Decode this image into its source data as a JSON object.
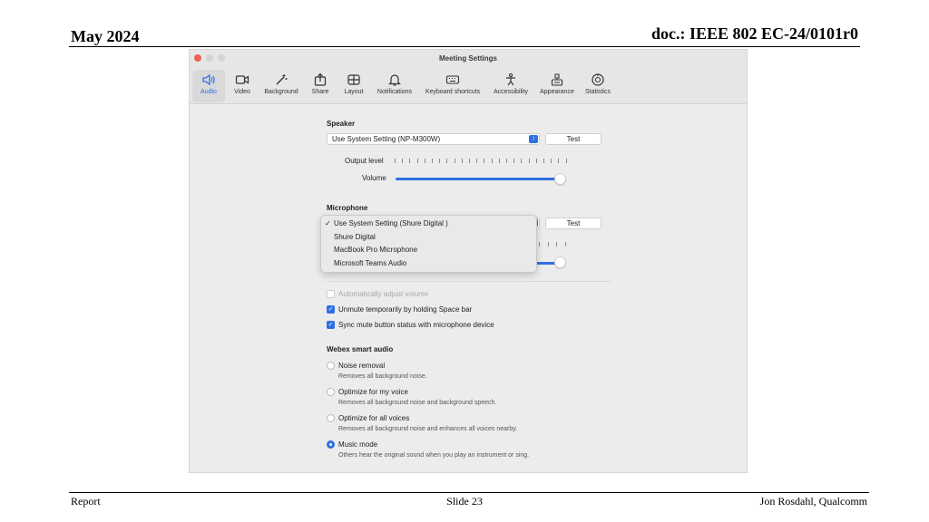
{
  "slide": {
    "date": "May 2024",
    "doc": "doc.: IEEE 802 EC-24/0101r0",
    "footer_left": "Report",
    "footer_center": "Slide 23",
    "footer_right": "Jon Rosdahl, Qualcomm"
  },
  "window": {
    "title": "Meeting Settings",
    "tabs": [
      {
        "label": "Audio",
        "icon": "speaker-icon",
        "active": true
      },
      {
        "label": "Video",
        "icon": "video-camera-icon"
      },
      {
        "label": "Background",
        "icon": "magic-wand-icon"
      },
      {
        "label": "Share",
        "icon": "share-upload-icon"
      },
      {
        "label": "Layout",
        "icon": "layout-grid-icon"
      },
      {
        "label": "Notifications",
        "icon": "bell-icon"
      },
      {
        "label": "Keyboard shortcuts",
        "icon": "keyboard-icon"
      },
      {
        "label": "Accessibility",
        "icon": "accessibility-person-icon"
      },
      {
        "label": "Appearance",
        "icon": "appearance-icon"
      },
      {
        "label": "Statistics",
        "icon": "statistics-gauge-icon"
      }
    ]
  },
  "speaker": {
    "heading": "Speaker",
    "device": "Use System Setting (NP-M300W)",
    "test_label": "Test",
    "output_level_label": "Output level",
    "volume_label": "Volume",
    "volume_fraction": 1.0
  },
  "microphone": {
    "heading": "Microphone",
    "test_label": "Test",
    "options": [
      {
        "label": "Use System Setting (Shure Digital   )",
        "selected": true
      },
      {
        "label": "Shure Digital"
      },
      {
        "label": "MacBook Pro Microphone"
      },
      {
        "label": "Microsoft Teams Audio"
      }
    ]
  },
  "checkboxes": [
    {
      "label": "Automatically adjust volume",
      "checked": false,
      "disabled": true
    },
    {
      "label": "Unmute temporarily by holding Space bar",
      "checked": true
    },
    {
      "label": "Sync mute button status with microphone device",
      "checked": true
    }
  ],
  "smart_audio": {
    "heading": "Webex smart audio",
    "options": [
      {
        "label": "Noise removal",
        "desc": "Removes all background noise.",
        "selected": false
      },
      {
        "label": "Optimize for my voice",
        "desc": "Removes all background noise and background speech.",
        "selected": false
      },
      {
        "label": "Optimize for all voices",
        "desc": "Removes all background noise and enhances all voices nearby.",
        "selected": false
      },
      {
        "label": "Music mode",
        "desc": "Others hear the original sound when you play an instrument or sing.",
        "selected": true
      }
    ]
  },
  "colors": {
    "accent": "#2f6fe4",
    "close_button": "#ee5f57"
  }
}
